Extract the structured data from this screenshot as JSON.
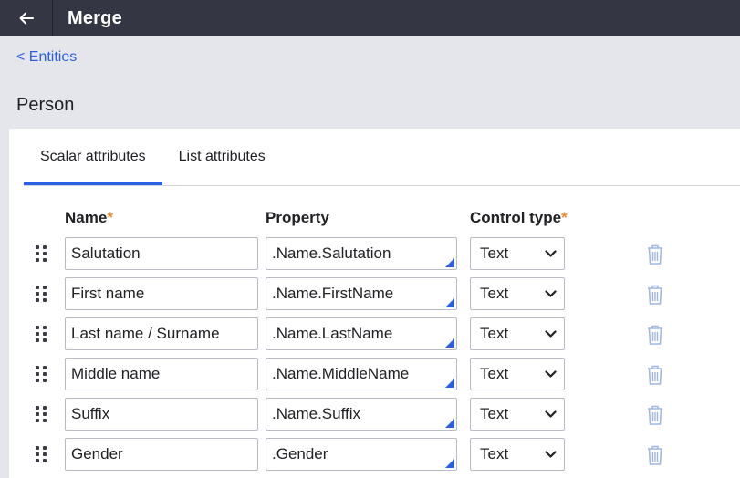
{
  "header": {
    "title": "Merge",
    "back_icon": "arrow-left-icon"
  },
  "breadcrumb": {
    "label": "< Entities"
  },
  "entity": {
    "title": "Person"
  },
  "tabs": [
    {
      "label": "Scalar attributes",
      "active": true
    },
    {
      "label": "List attributes",
      "active": false
    }
  ],
  "columns": {
    "name": "Name",
    "property": "Property",
    "control_type": "Control type",
    "required_marker": "*"
  },
  "rows": [
    {
      "name": "Salutation",
      "property": ".Name.Salutation",
      "control_type": "Text"
    },
    {
      "name": "First name",
      "property": ".Name.FirstName",
      "control_type": "Text"
    },
    {
      "name": "Last name / Surname",
      "property": ".Name.LastName",
      "control_type": "Text"
    },
    {
      "name": "Middle name",
      "property": ".Name.MiddleName",
      "control_type": "Text"
    },
    {
      "name": "Suffix",
      "property": ".Name.Suffix",
      "control_type": "Text"
    },
    {
      "name": "Gender",
      "property": ".Gender",
      "control_type": "Text"
    }
  ],
  "colors": {
    "topbar": "#343643",
    "accent": "#2b5fe3",
    "required": "#e78c2c",
    "trash": "#9db8e8"
  }
}
